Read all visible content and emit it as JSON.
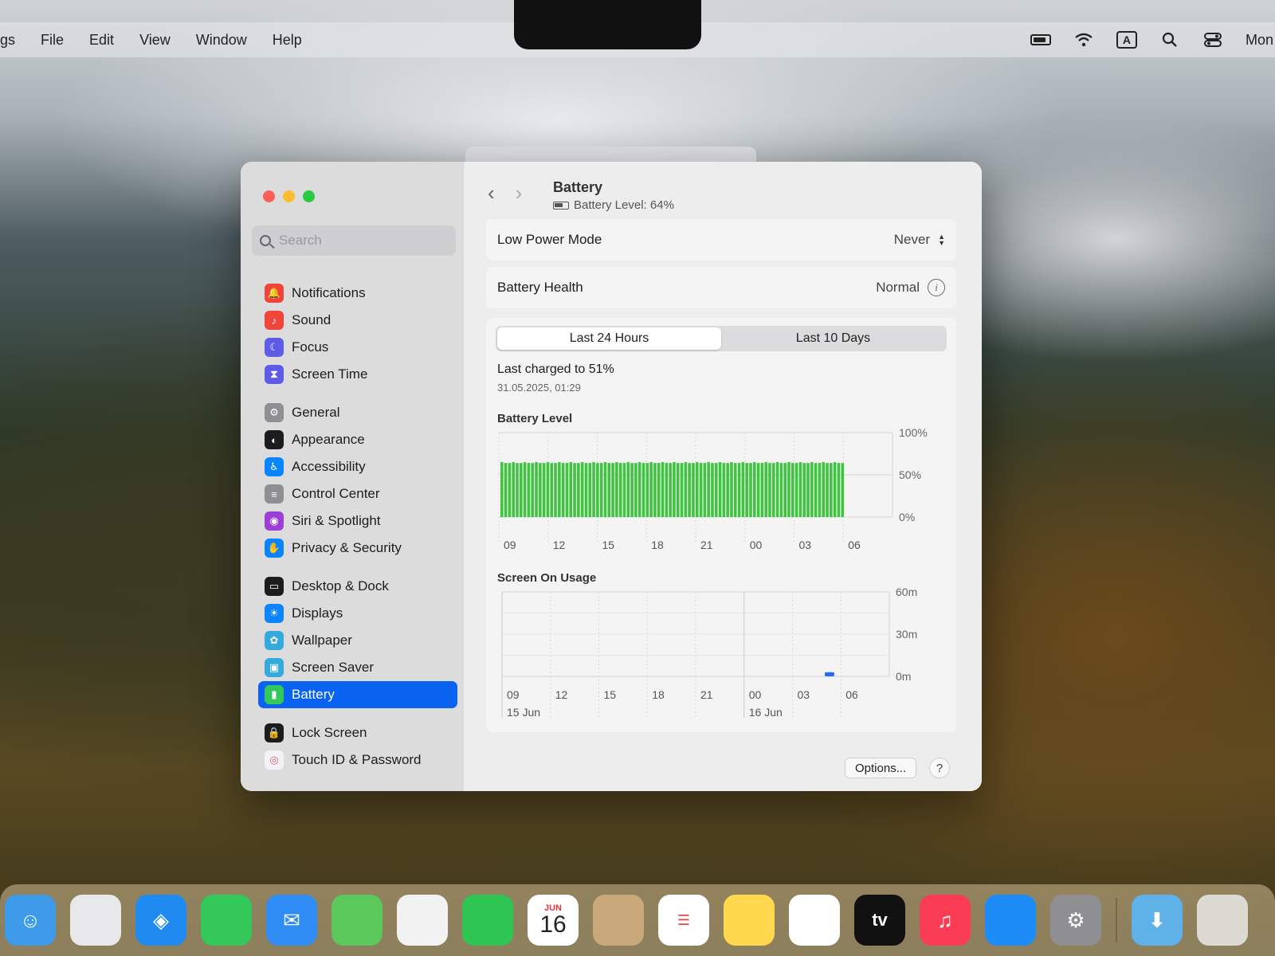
{
  "menubar": {
    "app_fragment": "gs",
    "items": [
      "File",
      "Edit",
      "View",
      "Window",
      "Help"
    ],
    "input_source": "A",
    "clock_fragment": "Mon"
  },
  "window": {
    "title": "Battery",
    "subtitle": "Battery Level: 64%"
  },
  "search": {
    "placeholder": "Search"
  },
  "sidebar": {
    "items": [
      {
        "label": "Notifications",
        "icon": "notifications-icon",
        "color": "#f0453a"
      },
      {
        "label": "Sound",
        "icon": "speaker-icon",
        "color": "#f0453a"
      },
      {
        "label": "Focus",
        "icon": "moon-icon",
        "color": "#5e5ce6"
      },
      {
        "label": "Screen Time",
        "icon": "hourglass-icon",
        "color": "#5e5ce6"
      },
      {
        "label": "General",
        "icon": "gear-icon",
        "color": "#8e8e93"
      },
      {
        "label": "Appearance",
        "icon": "appearance-icon",
        "color": "#1c1c1e"
      },
      {
        "label": "Accessibility",
        "icon": "accessibility-icon",
        "color": "#0a84ff"
      },
      {
        "label": "Control Center",
        "icon": "toggles-icon",
        "color": "#8e8e93"
      },
      {
        "label": "Siri & Spotlight",
        "icon": "siri-icon",
        "color": "#9b3fd6"
      },
      {
        "label": "Privacy & Security",
        "icon": "hand-icon",
        "color": "#0a84ff"
      },
      {
        "label": "Desktop & Dock",
        "icon": "dock-icon",
        "color": "#1c1c1e"
      },
      {
        "label": "Displays",
        "icon": "sun-icon",
        "color": "#0a84ff"
      },
      {
        "label": "Wallpaper",
        "icon": "flower-icon",
        "color": "#34aadc"
      },
      {
        "label": "Screen Saver",
        "icon": "screensaver-icon",
        "color": "#34aadc"
      },
      {
        "label": "Battery",
        "icon": "battery-icon",
        "color": "#34c759"
      },
      {
        "label": "Lock Screen",
        "icon": "lock-icon",
        "color": "#1c1c1e"
      },
      {
        "label": "Touch ID & Password",
        "icon": "fingerprint-icon",
        "color": "#f2f2f7"
      }
    ]
  },
  "low_power": {
    "label": "Low Power Mode",
    "value": "Never"
  },
  "battery_health": {
    "label": "Battery Health",
    "value": "Normal"
  },
  "tabs": [
    "Last 24 Hours",
    "Last 10 Days"
  ],
  "last_charged": {
    "text": "Last charged to 51%",
    "date": "31.05.2025, 01:29"
  },
  "chart_data": [
    {
      "type": "bar",
      "title": "Battery Level",
      "x_ticks": [
        "09",
        "12",
        "15",
        "18",
        "21",
        "00",
        "03",
        "06"
      ],
      "y_ticks": [
        "100%",
        "50%",
        "0%"
      ],
      "ylim": [
        0,
        100
      ],
      "series": [
        {
          "values_description_free": true,
          "level_percent": 64,
          "start_tick": "09",
          "end_tick": "06"
        }
      ],
      "color": "#3ec43e"
    },
    {
      "type": "bar",
      "title": "Screen On Usage",
      "x_ticks": [
        "09",
        "12",
        "15",
        "18",
        "21",
        "00",
        "03",
        "06"
      ],
      "x_dates": [
        "15 Jun",
        "16 Jun"
      ],
      "y_ticks": [
        "60m",
        "30m",
        "0m"
      ],
      "ylim": [
        0,
        60
      ],
      "usage_minutes": [
        {
          "at": "05",
          "minutes": 3
        }
      ],
      "color": "#2a6df4"
    }
  ],
  "buttons": {
    "options": "Options...",
    "help": "?"
  },
  "dock": {
    "apps": [
      {
        "name": "finder-icon",
        "color": "#3d9be9"
      },
      {
        "name": "launchpad-icon",
        "color": "#e8e8ea"
      },
      {
        "name": "safari-icon",
        "color": "#1f8bf0"
      },
      {
        "name": "messages-icon",
        "color": "#34c759"
      },
      {
        "name": "mail-icon",
        "color": "#2f8df5"
      },
      {
        "name": "maps-icon",
        "color": "#5ac85a"
      },
      {
        "name": "photos-icon",
        "color": "#f2f2f2"
      },
      {
        "name": "facetime-icon",
        "color": "#2fc552"
      },
      {
        "name": "calendar-icon",
        "color": "#ffffff"
      },
      {
        "name": "contacts-icon",
        "color": "#c9a97a"
      },
      {
        "name": "reminders-icon",
        "color": "#ffffff"
      },
      {
        "name": "notes-icon",
        "color": "#ffd84d"
      },
      {
        "name": "freeform-icon",
        "color": "#ffffff"
      },
      {
        "name": "tv-icon",
        "color": "#111111"
      },
      {
        "name": "music-icon",
        "color": "#fa3d55"
      },
      {
        "name": "app-store-icon",
        "color": "#1d8cf7"
      },
      {
        "name": "system-settings-icon",
        "color": "#8e8e93"
      }
    ],
    "calendar_month": "JUN",
    "calendar_day": "16",
    "tv_label": "tv"
  }
}
